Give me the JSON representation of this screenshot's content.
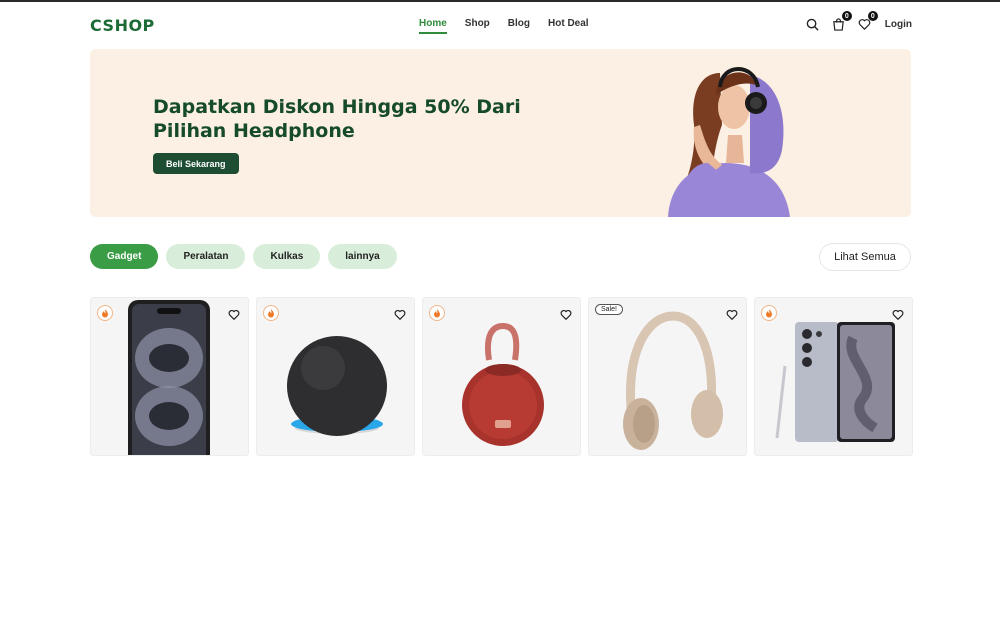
{
  "brand": {
    "logo": "CSHOP",
    "accent": "#2e8b3a",
    "dark_green": "#1d4e33"
  },
  "nav": {
    "items": [
      "Home",
      "Shop",
      "Blog",
      "Hot Deal"
    ],
    "active": "Home"
  },
  "header_icons": {
    "search": "search-icon",
    "cart": {
      "icon": "cart-icon",
      "count": "0"
    },
    "wishlist": {
      "icon": "heart-icon",
      "count": "0"
    },
    "login_label": "Login"
  },
  "hero": {
    "title": "Dapatkan Diskon Hingga 50% Dari Pilihan Headphone",
    "button_label": "Beli Sekarang",
    "background": "#fcefe3"
  },
  "categories": {
    "items": [
      "Gadget",
      "Peralatan",
      "Kulkas",
      "lainnya"
    ],
    "active": "Gadget",
    "see_all_label": "Lihat Semua"
  },
  "products": [
    {
      "image": "smartphone",
      "badge_icon": "fire-icon"
    },
    {
      "image": "smart-speaker",
      "badge_icon": "fire-icon"
    },
    {
      "image": "bluetooth-speaker",
      "badge_icon": "fire-icon"
    },
    {
      "image": "headphones",
      "badge_text": "Sale!"
    },
    {
      "image": "android-phone",
      "badge_icon": "fire-icon"
    }
  ]
}
